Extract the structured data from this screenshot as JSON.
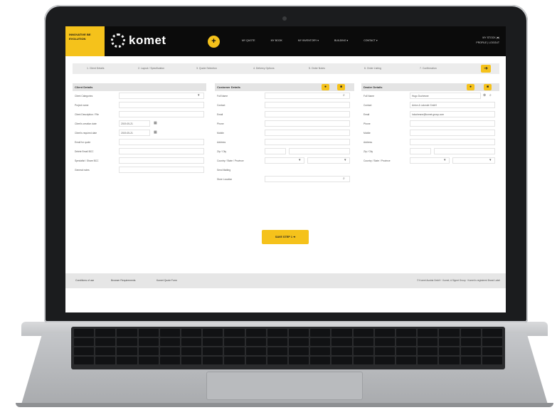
{
  "header": {
    "badge_line1": "INNOVATIVE BE",
    "badge_line2": "EVOLUTION",
    "logo_text": "komet",
    "nav": [
      "MY QUOTE",
      "MY BOOK",
      "MY INVENTORY ▾",
      "BUILDING ▾",
      "CONTACT ▾"
    ],
    "account_line1": "MY STOCK (■)",
    "account_line2": "PROFILE | LOGOUT"
  },
  "steps": [
    "1. Client Details",
    "2. Layout / Specification",
    "3. Quote Selection",
    "4. Delivery Options",
    "5. Order Notes",
    "6. Order Listing",
    "7. Confirmation"
  ],
  "client_details": {
    "title": "Client Details",
    "rows": [
      {
        "label": "Client Categories",
        "value": ""
      },
      {
        "label": "Project name",
        "value": ""
      },
      {
        "label": "Client Description / File",
        "value": ""
      },
      {
        "label": "Client's creation date",
        "value": "2019-05-21"
      },
      {
        "label": "Client's required date",
        "value": "2019-05-21"
      },
      {
        "label": "Email for quote",
        "value": ""
      },
      {
        "label": "Delete Email BCC",
        "value": ""
      },
      {
        "label": "Specialist / Share BCC",
        "value": ""
      },
      {
        "label": "General notes",
        "value": ""
      }
    ]
  },
  "customer_details": {
    "title": "Customer Details",
    "rows": [
      {
        "label": "Full Name",
        "value": ""
      },
      {
        "label": "Contact",
        "value": ""
      },
      {
        "label": "Email",
        "value": ""
      },
      {
        "label": "Phone",
        "value": ""
      },
      {
        "label": "Mobile",
        "value": ""
      },
      {
        "label": "Address",
        "value": ""
      },
      {
        "label": "Zip / City",
        "value": ""
      },
      {
        "label": "Country / State / Province",
        "value": ""
      },
      {
        "label": "Send Mailing",
        "value": ""
      },
      {
        "label": "Store Location",
        "value": ""
      }
    ]
  },
  "dealer_details": {
    "title": "Dealer Details",
    "rows": [
      {
        "label": "Full Name",
        "value": "Hugo Duchesne"
      },
      {
        "label": "Contact",
        "value": "Anton & Lalonde GmbH"
      },
      {
        "label": "Email",
        "value": "hduchesne@komet-group.com"
      },
      {
        "label": "Phone",
        "value": ""
      },
      {
        "label": "Mobile",
        "value": ""
      },
      {
        "label": "Address",
        "value": ""
      },
      {
        "label": "Zip / City",
        "value": ""
      },
      {
        "label": "Country / State / Province",
        "value": ""
      }
    ]
  },
  "save_button": "SAVE STEP 1  ➜",
  "footer": {
    "links": [
      "Conditions of use",
      "Browser Requirements",
      "Komet Quote Form"
    ],
    "copyright": "© Komet Austria GmbH · Komet, A Signet Group · Komet is registered Brand Label"
  },
  "colors": {
    "accent": "#f5c21b",
    "header_bg": "#0b0b0b"
  }
}
